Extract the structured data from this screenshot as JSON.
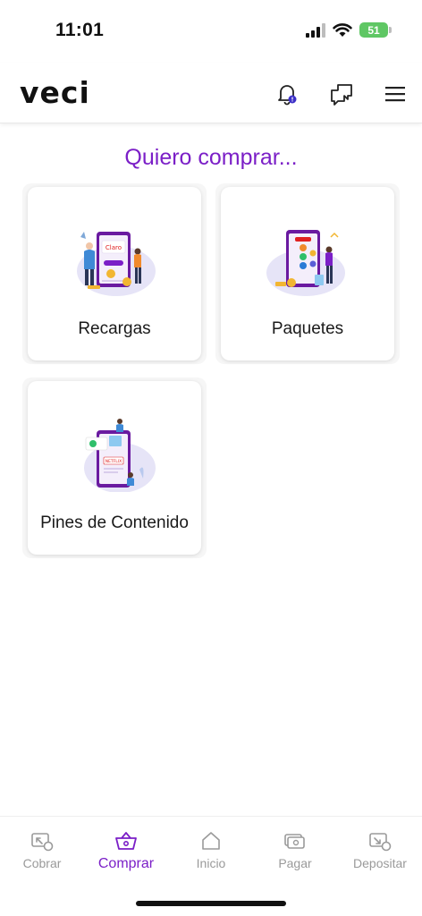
{
  "status_bar": {
    "time": "11:01",
    "battery": "51"
  },
  "header": {
    "logo": "veci"
  },
  "main": {
    "title": "Quiero comprar...",
    "cards": [
      {
        "label": "Recargas",
        "illus_text": "Claro"
      },
      {
        "label": "Paquetes"
      },
      {
        "label": "Pines de Contenido",
        "illus_text": "NETFLIX"
      }
    ]
  },
  "bottom_nav": {
    "items": [
      {
        "label": "Cobrar"
      },
      {
        "label": "Comprar"
      },
      {
        "label": "Inicio"
      },
      {
        "label": "Pagar"
      },
      {
        "label": "Depositar"
      }
    ]
  },
  "colors": {
    "accent": "#7b1fc7",
    "inactive": "#9a9a9a",
    "battery": "#5fc764"
  }
}
